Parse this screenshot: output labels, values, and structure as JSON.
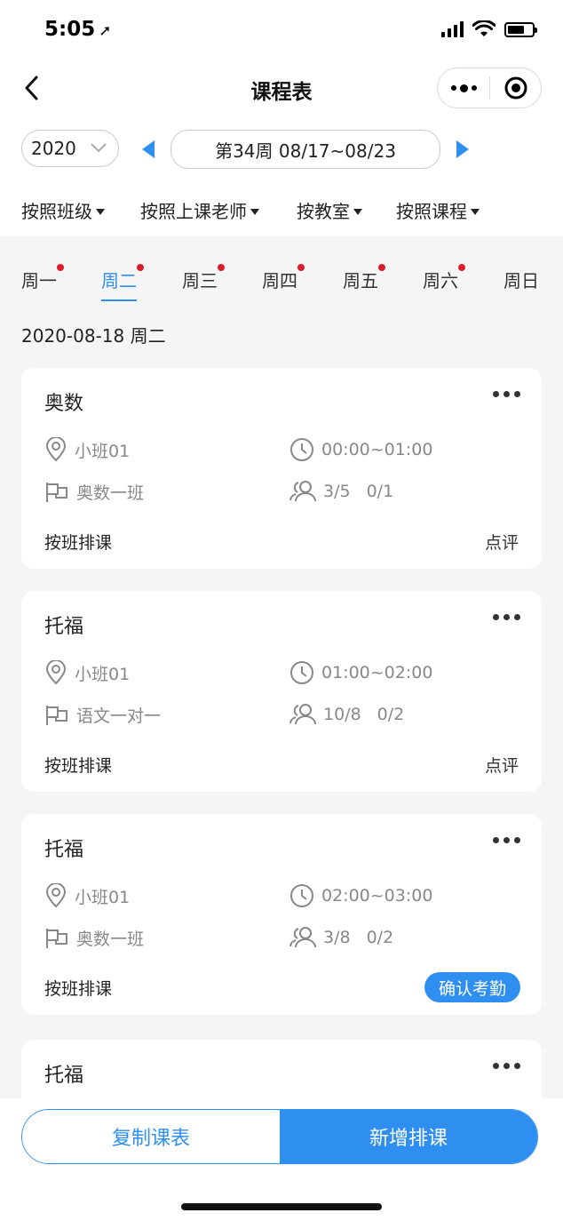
{
  "status": {
    "time": "5:05",
    "location_arrow": "➚"
  },
  "nav": {
    "title": "课程表"
  },
  "week": {
    "year": "2020",
    "label": "第34周 08/17~08/23"
  },
  "filters": [
    "按照班级",
    "按照上课老师",
    "按教室",
    "按照课程"
  ],
  "days": [
    {
      "label": "周一",
      "dot": true
    },
    {
      "label": "周二",
      "dot": true,
      "active": true
    },
    {
      "label": "周三",
      "dot": true
    },
    {
      "label": "周四",
      "dot": true
    },
    {
      "label": "周五",
      "dot": true
    },
    {
      "label": "周六",
      "dot": true
    },
    {
      "label": "周日",
      "dot": false
    }
  ],
  "selected_date": "2020-08-18 周二",
  "cards": [
    {
      "title": "奥数",
      "room": "小班01",
      "time": "00:00~01:00",
      "class": "奥数一班",
      "count": "3/5",
      "extra": "0/1",
      "mode": "按班排课",
      "action": "点评"
    },
    {
      "title": "托福",
      "room": "小班01",
      "time": "01:00~02:00",
      "class": "语文一对一",
      "count": "10/8",
      "extra": "0/2",
      "mode": "按班排课",
      "action": "点评"
    },
    {
      "title": "托福",
      "room": "小班01",
      "time": "02:00~03:00",
      "class": "奥数一班",
      "count": "3/8",
      "extra": "0/2",
      "mode": "按班排课",
      "action": "确认考勤"
    },
    {
      "title": "托福"
    }
  ],
  "bottom": {
    "copy": "复制课表",
    "add": "新增排课"
  },
  "colors": {
    "accent": "#2f8ff0",
    "dot": "#d71e2a",
    "background": "#f5f5f5"
  }
}
